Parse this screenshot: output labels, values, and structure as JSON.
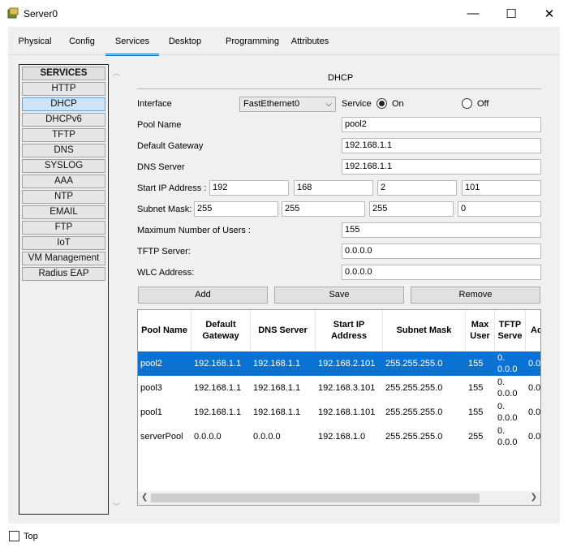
{
  "window": {
    "title": "Server0",
    "minimize_glyph": "—",
    "maximize_glyph": "☐",
    "close_glyph": "✕"
  },
  "tabs": [
    {
      "label": "Physical"
    },
    {
      "label": "Config"
    },
    {
      "label": "Services"
    },
    {
      "label": "Desktop"
    },
    {
      "label": "Programming"
    },
    {
      "label": "Attributes"
    }
  ],
  "active_tab": "Services",
  "services": {
    "header": "SERVICES",
    "items": [
      "HTTP",
      "DHCP",
      "DHCPv6",
      "TFTP",
      "DNS",
      "SYSLOG",
      "AAA",
      "NTP",
      "EMAIL",
      "FTP",
      "IoT",
      "VM Management",
      "Radius EAP"
    ],
    "selected": "DHCP"
  },
  "dhcp": {
    "title": "DHCP",
    "interface_label": "Interface",
    "interface_value": "FastEthernet0",
    "service_label": "Service",
    "on_label": "On",
    "off_label": "Off",
    "service_state": "On",
    "pool_name_label": "Pool Name",
    "pool_name_value": "pool2",
    "default_gateway_label": "Default Gateway",
    "default_gateway_value": "192.168.1.1",
    "dns_server_label": "DNS Server",
    "dns_server_value": "192.168.1.1",
    "start_ip_label": "Start IP Address :",
    "start_ip": [
      "192",
      "168",
      "2",
      "101"
    ],
    "subnet_mask_label": "Subnet Mask:",
    "subnet_mask": [
      "255",
      "255",
      "255",
      "0"
    ],
    "max_users_label": "Maximum Number of Users :",
    "max_users_value": "155",
    "tftp_server_label": "TFTP Server:",
    "tftp_server_value": "0.0.0.0",
    "wlc_address_label": "WLC Address:",
    "wlc_address_value": "0.0.0.0",
    "add_label": "Add",
    "save_label": "Save",
    "remove_label": "Remove"
  },
  "table": {
    "headers": [
      "Pool Name",
      "Default Gateway",
      "DNS Server",
      "Start IP Address",
      "Subnet Mask",
      "Max User",
      "TFTP Serve",
      "Ad"
    ],
    "rows": [
      {
        "pool": "pool2",
        "gateway": "192.168.1.1",
        "dns": "192.168.1.1",
        "start": "192.168.2.101",
        "mask": "255.255.255.0",
        "max": "155",
        "tftp": "0.\n0.0.0",
        "ad": "0.0"
      },
      {
        "pool": "pool3",
        "gateway": "192.168.1.1",
        "dns": "192.168.1.1",
        "start": "192.168.3.101",
        "mask": "255.255.255.0",
        "max": "155",
        "tftp": "0.\n0.0.0",
        "ad": "0.0"
      },
      {
        "pool": "pool1",
        "gateway": "192.168.1.1",
        "dns": "192.168.1.1",
        "start": "192.168.1.101",
        "mask": "255.255.255.0",
        "max": "155",
        "tftp": "0.\n0.0.0",
        "ad": "0.0"
      },
      {
        "pool": "serverPool",
        "gateway": "0.0.0.0",
        "dns": "0.0.0.0",
        "start": "192.168.1.0",
        "mask": "255.255.255.0",
        "max": "255",
        "tftp": "0.\n0.0.0",
        "ad": "0.0"
      }
    ],
    "selected_row": 0
  },
  "footer": {
    "top_label": "Top"
  },
  "colors": {
    "accent": "#0f6cbd",
    "selection": "#0a72d2"
  }
}
